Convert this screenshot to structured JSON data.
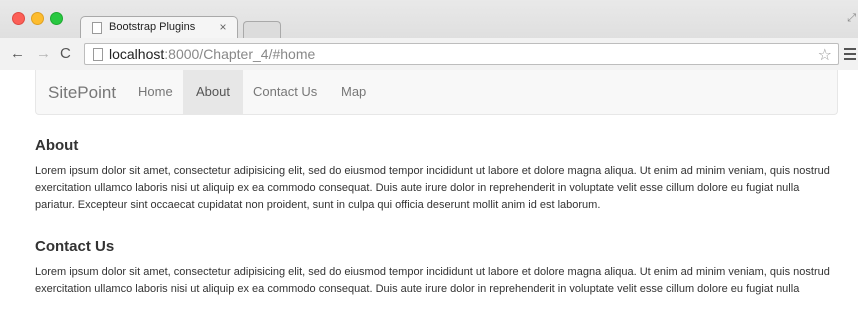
{
  "browser": {
    "tab_title": "Bootstrap Plugins",
    "tab_close": "×",
    "url_host": "localhost",
    "url_rest": ":8000/Chapter_4/#home",
    "icons": {
      "back": "←",
      "forward": "→",
      "reload": "C",
      "star": "☆",
      "fullscreen": "⤢"
    }
  },
  "navbar": {
    "brand": "SitePoint",
    "links": [
      {
        "label": "Home",
        "active": false
      },
      {
        "label": "About",
        "active": true
      },
      {
        "label": "Contact Us",
        "active": false
      },
      {
        "label": "Map",
        "active": false
      }
    ]
  },
  "sections": [
    {
      "heading": "About",
      "text": "Lorem ipsum dolor sit amet, consectetur adipisicing elit, sed do eiusmod tempor incididunt ut labore et dolore magna aliqua. Ut enim ad minim veniam, quis nostrud exercitation ullamco laboris nisi ut aliquip ex ea commodo consequat. Duis aute irure dolor in reprehenderit in voluptate velit esse cillum dolore eu fugiat nulla pariatur. Excepteur sint occaecat cupidatat non proident, sunt in culpa qui officia deserunt mollit anim id est laborum."
    },
    {
      "heading": "Contact Us",
      "text": "Lorem ipsum dolor sit amet, consectetur adipisicing elit, sed do eiusmod tempor incididunt ut labore et dolore magna aliqua. Ut enim ad minim veniam, quis nostrud exercitation ullamco laboris nisi ut aliquip ex ea commodo consequat. Duis aute irure dolor in reprehenderit in voluptate velit esse cillum dolore eu fugiat nulla pariatur. Excepteur sint occaecat cupidatat non proident, sunt in culpa qui officia deserunt mollit anim id est laborum."
    }
  ],
  "colors": {
    "navbar_bg": "#f8f8f8",
    "active_link_bg": "#e7e7e7",
    "link_text": "#777777",
    "body_text": "#333333"
  }
}
